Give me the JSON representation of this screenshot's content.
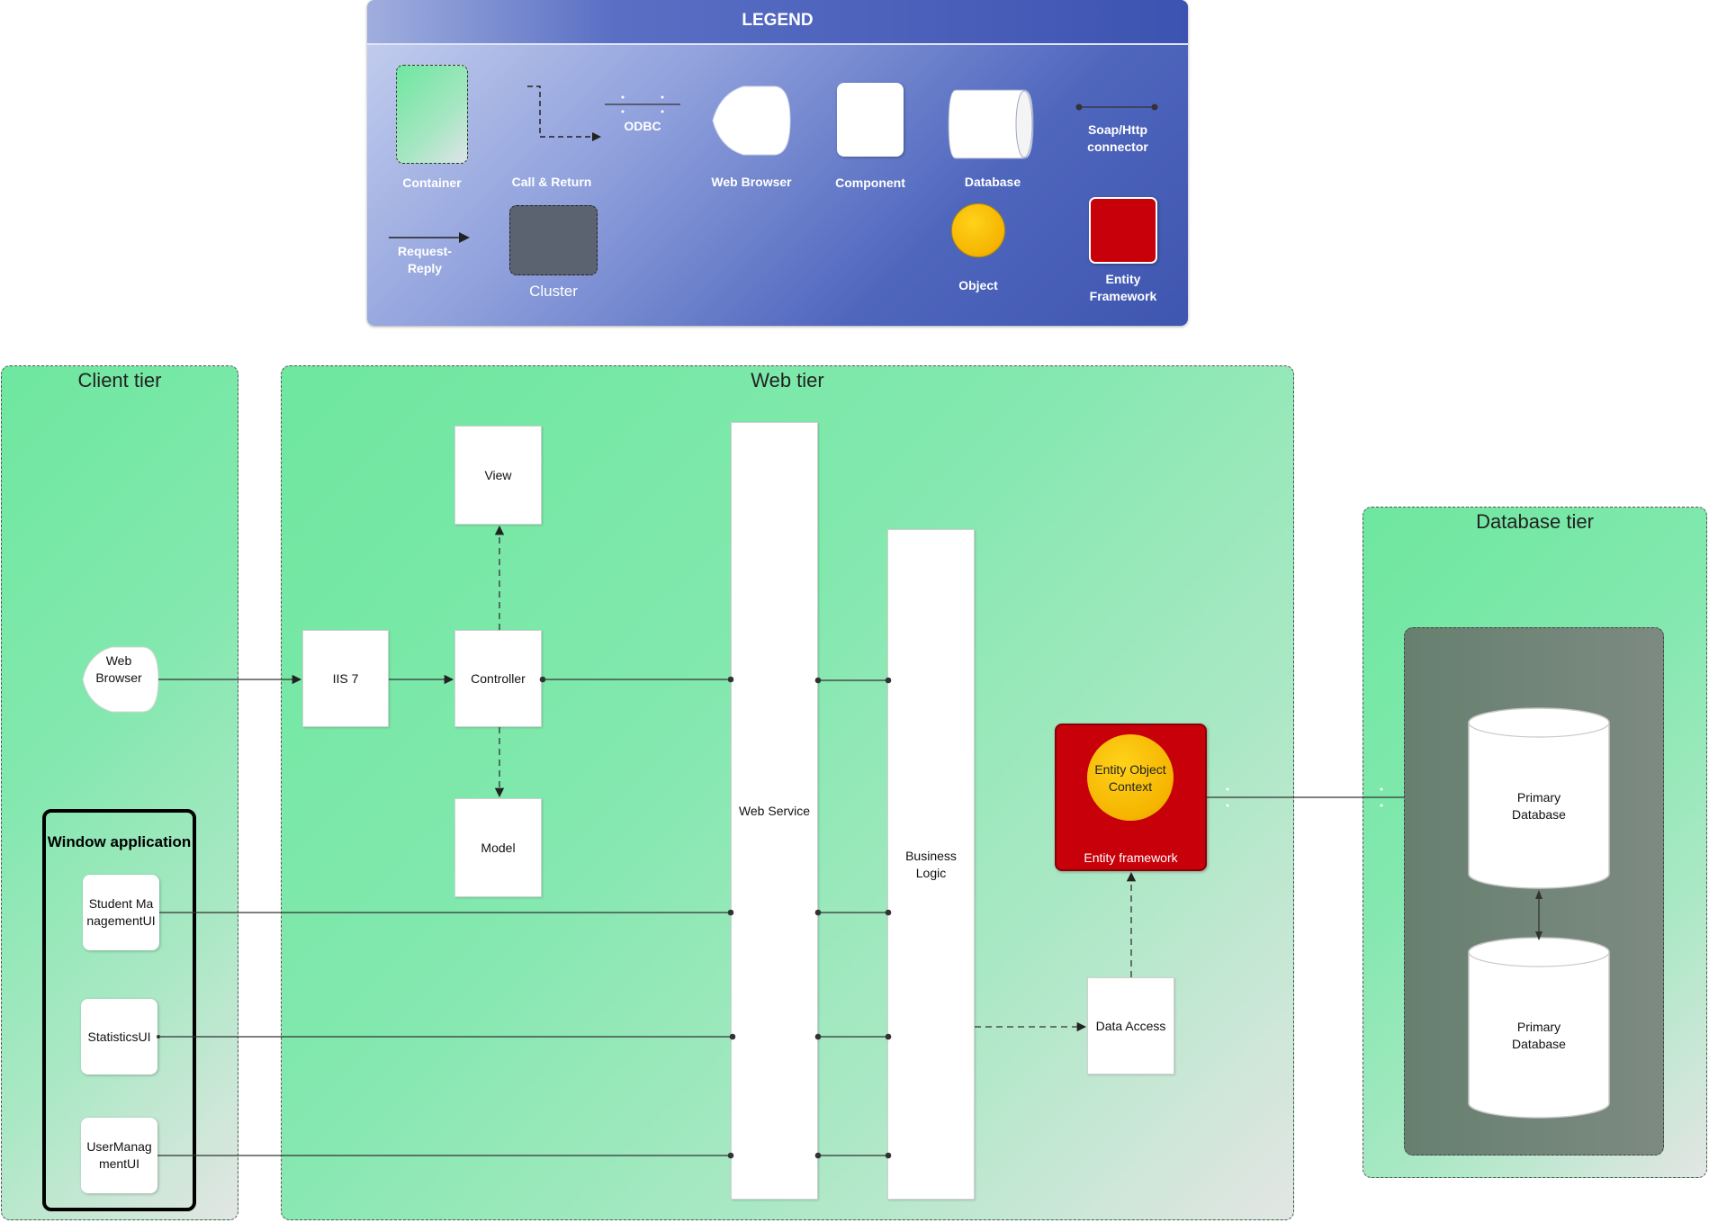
{
  "legend": {
    "title": "LEGEND",
    "container": "Container",
    "call_return": "Call & Return",
    "odbc": "ODBC",
    "web_browser": "Web Browser",
    "component": "Component",
    "database": "Database",
    "soap_http": "Soap/Http connector",
    "request_reply": "Request-Reply",
    "cluster": "Cluster",
    "object": "Object",
    "entity_framework": "Entity Framework"
  },
  "tiers": {
    "client": "Client tier",
    "web": "Web tier",
    "database": "Database tier"
  },
  "client": {
    "web_browser": "Web Browser",
    "window_application": "Window application",
    "student_ui": "Student ManagementUI",
    "statistics_ui": "StatisticsUI",
    "user_ui": "UserManagmentUI"
  },
  "web": {
    "iis": "IIS 7",
    "controller": "Controller",
    "view": "View",
    "model": "Model",
    "web_service": "Web Service",
    "business_logic": "Business Logic",
    "entity_object_context": "Entity Object Context",
    "entity_framework": "Entity framework",
    "data_access": "Data Access"
  },
  "database": {
    "primary_db_1": "Primary Database",
    "primary_db_2": "Primary Database"
  },
  "colors": {
    "tier_green": "#6ee79f",
    "legend_blue": "#3f56b0",
    "entity_red": "#c8000a",
    "object_yellow": "#f5b400",
    "cluster_gray": "#6f8076"
  }
}
